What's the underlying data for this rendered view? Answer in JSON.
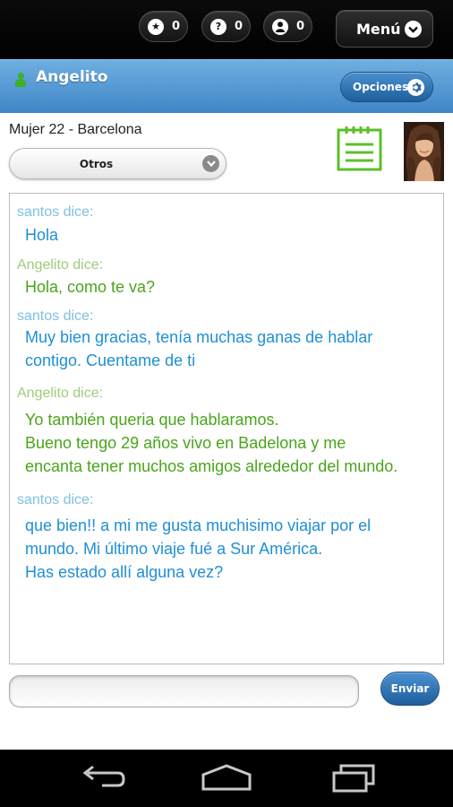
{
  "topbar": {
    "counters": [
      {
        "icon": "star-icon",
        "glyph": "★",
        "value": "0"
      },
      {
        "icon": "question-icon",
        "glyph": "?",
        "value": "0"
      },
      {
        "icon": "user-icon",
        "glyph": "●",
        "value": "0"
      }
    ],
    "menu_label": "Menú"
  },
  "header": {
    "username": "Angelito",
    "options_label": "Opciones"
  },
  "profile": {
    "info": "Mujer 22 - Barcelona",
    "category_selected": "Otros"
  },
  "chat": {
    "messages": [
      {
        "sender": "santos",
        "header": "santos dice:",
        "lines": [
          "Hola"
        ]
      },
      {
        "sender": "angelito",
        "header": "Angelito dice:",
        "lines": [
          "Hola, como te va?"
        ]
      },
      {
        "sender": "santos",
        "header": "santos dice:",
        "lines": [
          "Muy bien gracias, tenía muchas ganas de hablar",
          "contigo. Cuentame de ti"
        ]
      },
      {
        "sender": "angelito",
        "header": "Angelito dice:",
        "lines": [
          "Yo también queria que hablaramos.",
          "Bueno tengo 29 años vivo en Badelona y me",
          "encanta tener muchos amigos alrededor del mundo."
        ]
      },
      {
        "sender": "santos",
        "header": "santos dice:",
        "lines": [
          "que bien!! a mi me gusta muchisimo viajar por el",
          "mundo. Mi último viaje fué a Sur América.",
          "Has estado allí alguna vez?"
        ]
      }
    ]
  },
  "composer": {
    "input_value": "",
    "send_label": "Enviar"
  },
  "colors": {
    "santos_header": "#7fbfe0",
    "santos_text": "#1f8fd6",
    "angelito_header": "#9fcc7a",
    "angelito_text": "#4aa51c",
    "header_blue": "#4f95d2"
  }
}
